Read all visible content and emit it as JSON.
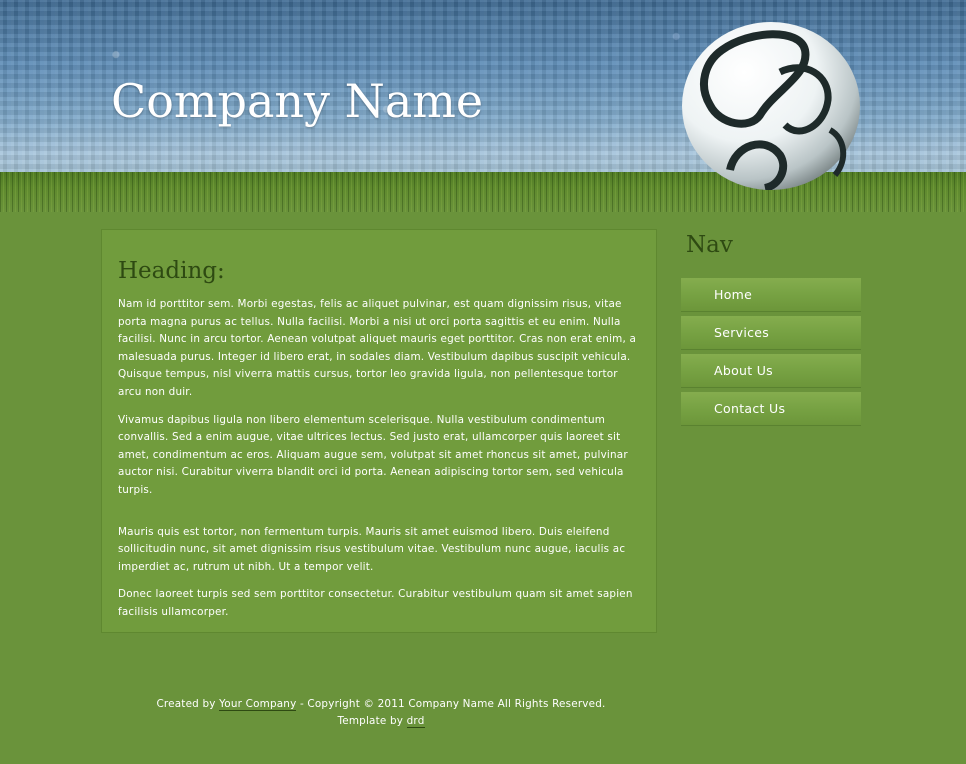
{
  "header": {
    "company_name": "Company Name"
  },
  "content": {
    "heading": "Heading:",
    "paragraphs": [
      "Nam id porttitor sem. Morbi egestas, felis ac aliquet pulvinar, est quam dignissim risus, vitae porta magna purus ac tellus. Nulla facilisi. Morbi a nisi ut orci porta sagittis et eu enim. Nulla facilisi. Nunc in arcu tortor. Aenean volutpat aliquet mauris eget porttitor. Cras non erat enim, a malesuada purus. Integer id libero erat, in sodales diam. Vestibulum dapibus suscipit vehicula. Quisque tempus, nisl viverra mattis cursus, tortor leo gravida ligula, non pellentesque tortor arcu non duir.",
      "Vivamus dapibus ligula non libero elementum scelerisque. Nulla vestibulum condimentum convallis. Sed a enim augue, vitae ultrices lectus. Sed justo erat, ullamcorper quis laoreet sit amet, condimentum ac eros. Aliquam augue sem, volutpat sit amet rhoncus sit amet, pulvinar auctor nisi. Curabitur viverra blandit orci id porta. Aenean adipiscing tortor sem, sed vehicula turpis.",
      "Mauris quis est tortor, non fermentum turpis. Mauris sit amet euismod libero. Duis eleifend sollicitudin nunc, sit amet dignissim risus vestibulum vitae. Vestibulum nunc augue, iaculis ac imperdiet ac, rutrum ut nibh. Ut a tempor velit.",
      "Donec laoreet turpis sed sem porttitor consectetur. Curabitur vestibulum quam sit amet sapien facilisis ullamcorper."
    ]
  },
  "nav": {
    "title": "Nav",
    "items": [
      {
        "label": "Home"
      },
      {
        "label": "Services"
      },
      {
        "label": "About Us"
      },
      {
        "label": "Contact Us"
      }
    ]
  },
  "footer": {
    "created_by": "Created by",
    "company_link": "Your Company",
    "copyright": "- Copyright © 2011 Company Name All Rights Reserved.",
    "template_by": "Template by",
    "drd_link": "drd"
  },
  "colors": {
    "background": "#6a933b",
    "heading": "#2e4a12",
    "content_box": "#719c3d"
  },
  "icons": {
    "ball": "soccer-ball-icon"
  }
}
